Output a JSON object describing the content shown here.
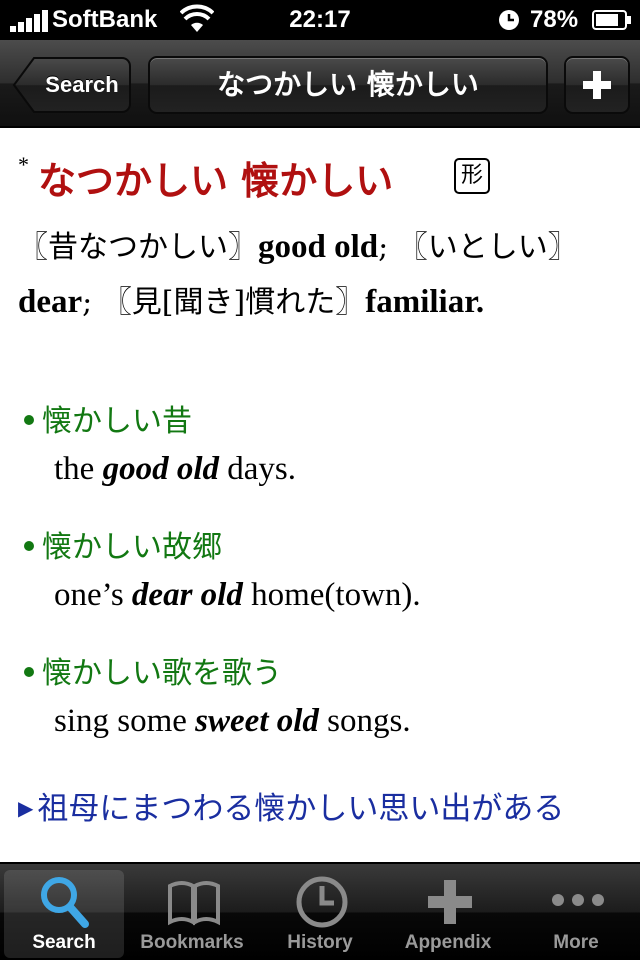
{
  "status_bar": {
    "carrier": "SoftBank",
    "time": "22:17",
    "battery": "78%"
  },
  "nav": {
    "back_label": "Search",
    "title": "なつかしい 懐かしい"
  },
  "entry": {
    "asterisk": "*",
    "headword": "なつかしい 懐かしい",
    "pos": "形",
    "definition": {
      "s1_jp": "〖昔なつかしい〗",
      "s1_en": "good old",
      "sep1": "; ",
      "s2_jp": "〖いとしい〗",
      "s2_en": "dear",
      "sep2": "; ",
      "s3_jp": "〖見[聞き]慣れた〗",
      "s3_en": "familiar."
    },
    "examples": [
      {
        "jp": "懐かしい昔",
        "en_pre": "the ",
        "en_bold": "good old",
        "en_post": " days."
      },
      {
        "jp": "懐かしい故郷",
        "en_pre": "one’s ",
        "en_bold": "dear old",
        "en_post": " home(town)."
      },
      {
        "jp": "懐かしい歌を歌う",
        "en_pre": "sing some ",
        "en_bold": "sweet old",
        "en_post": " songs."
      }
    ],
    "link_text": "祖母にまつわる懐かしい思い出がある"
  },
  "tabs": [
    {
      "label": "Search",
      "icon": "magnifier-icon",
      "selected": true
    },
    {
      "label": "Bookmarks",
      "icon": "book-icon",
      "selected": false
    },
    {
      "label": "History",
      "icon": "clock-icon",
      "selected": false
    },
    {
      "label": "Appendix",
      "icon": "plus-icon",
      "selected": false
    },
    {
      "label": "More",
      "icon": "ellipsis-icon",
      "selected": false
    }
  ],
  "colors": {
    "headword": "#b01010",
    "example_jp": "#127812",
    "link": "#1a2ea0",
    "tab_selected_icon": "#3fa7e6"
  }
}
